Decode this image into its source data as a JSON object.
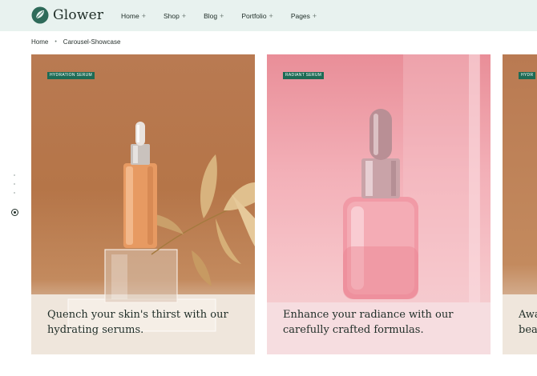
{
  "brand": {
    "name": "Glower",
    "accent": "#1d6b55"
  },
  "nav": {
    "items": [
      {
        "label": "Home",
        "indicator": "+"
      },
      {
        "label": "Shop",
        "indicator": "+"
      },
      {
        "label": "Blog",
        "indicator": "+"
      },
      {
        "label": "Portfolio",
        "indicator": "+"
      },
      {
        "label": "Pages",
        "indicator": "+"
      }
    ]
  },
  "breadcrumb": {
    "home": "Home",
    "separator": "•",
    "current": "Carousel-Showcase"
  },
  "carousel": {
    "cards": [
      {
        "badge": "HYDRATION SERUM",
        "caption_line1": "Quench your skin's thirst with our",
        "caption_line2": "hydrating serums."
      },
      {
        "badge": "RADIANT SERUM",
        "caption_line1": "Enhance your radiance with our",
        "caption_line2": "carefully crafted formulas."
      },
      {
        "badge": "HYDR",
        "caption_line1": "Awa",
        "caption_line2": "bea"
      }
    ]
  }
}
